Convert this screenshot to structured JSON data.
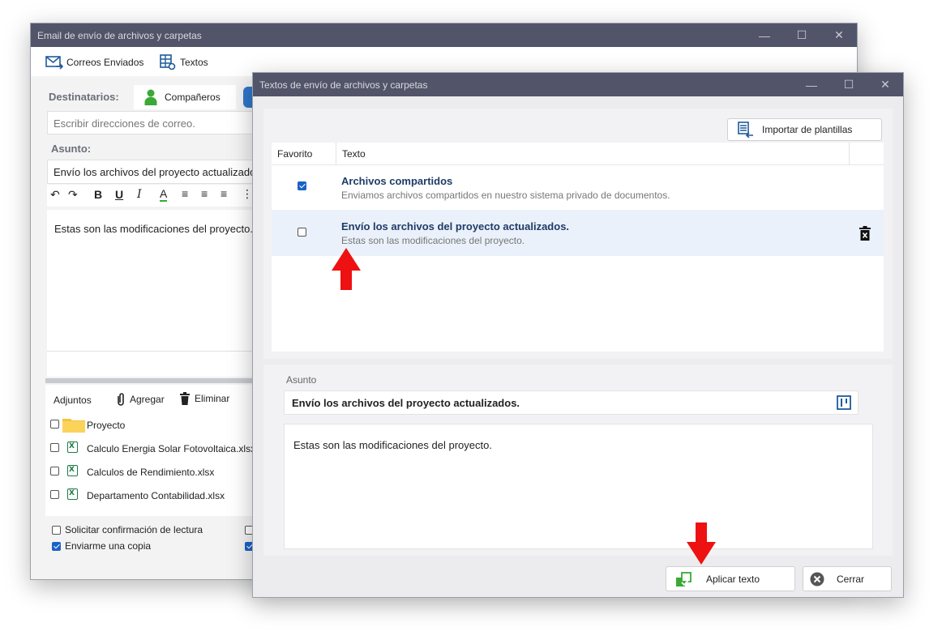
{
  "back_window": {
    "title": "Email de envío de archivos y carpetas",
    "toolbar": {
      "sent_label": "Correos Enviados",
      "texts_label": "Textos"
    },
    "recipients_label": "Destinatarios:",
    "tab_colleagues": "Compañeros",
    "address_placeholder": "Escribir direcciones de correo.",
    "subject_label": "Asunto:",
    "subject_value": "Envío los archivos del proyecto actualizados.",
    "body_text": "Estas son las modificaciones del proyecto.",
    "attachments": {
      "label": "Adjuntos",
      "add_label": "Agregar",
      "delete_label": "Eliminar",
      "files": [
        {
          "name": "Proyecto",
          "type": "folder"
        },
        {
          "name": "Calculo Energia Solar Fotovoltaica.xlsx",
          "type": "xlsx"
        },
        {
          "name": "Calculos de Rendimiento.xlsx",
          "type": "xlsx"
        },
        {
          "name": "Departamento Contabilidad.xlsx",
          "type": "xlsx"
        }
      ]
    },
    "options": {
      "read_receipt": "Solicitar confirmación de lectura",
      "send_copy": "Enviarme una copia",
      "send_copy_checked": true,
      "read_receipt_checked": false
    }
  },
  "front_window": {
    "title": "Textos de envío de archivos y carpetas",
    "import_button": "Importar de plantillas",
    "table": {
      "col_favorite": "Favorito",
      "col_text": "Texto",
      "rows": [
        {
          "title": "Archivos compartidos",
          "subtitle": "Enviamos archivos compartidos en nuestro sistema privado de documentos.",
          "favorite": true
        },
        {
          "title": "Envío los archivos del proyecto actualizados.",
          "subtitle": "Estas son las modificaciones del proyecto.",
          "favorite": false
        }
      ]
    },
    "subject_label": "Asunto",
    "subject_value": "Envío los archivos del proyecto actualizados.",
    "body_text": "Estas son las modificaciones del proyecto.",
    "apply_button": "Aplicar texto",
    "close_button": "Cerrar"
  },
  "colors": {
    "titlebar": "#525569",
    "accent_blue": "#1a63c6",
    "annotation_red": "#ee1111",
    "selected_row": "#eaf1fa",
    "green_icon": "#3aa935"
  }
}
